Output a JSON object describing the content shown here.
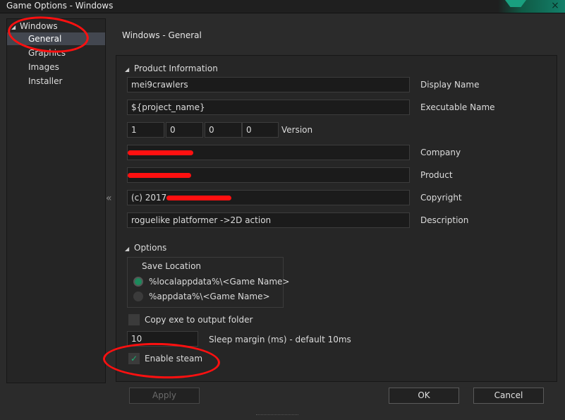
{
  "window": {
    "title": "Game Options - Windows"
  },
  "tree": {
    "root": "Windows",
    "items": [
      {
        "label": "General",
        "selected": true
      },
      {
        "label": "Graphics",
        "selected": false
      },
      {
        "label": "Images",
        "selected": false
      },
      {
        "label": "Installer",
        "selected": false
      }
    ]
  },
  "page": {
    "title": "Windows - General"
  },
  "product_info": {
    "heading": "Product Information",
    "display_name": {
      "value": "mei9crawlers",
      "label": "Display Name"
    },
    "executable_name": {
      "value": "${project_name}",
      "label": "Executable Name"
    },
    "version": {
      "major": "1",
      "minor": "0",
      "build": "0",
      "revision": "0",
      "label": "Version"
    },
    "company": {
      "value": "",
      "label": "Company"
    },
    "product": {
      "value": "",
      "label": "Product"
    },
    "copyright": {
      "value": "(c) 2017",
      "label": "Copyright"
    },
    "description": {
      "value": "roguelike platformer ->2D action",
      "label": "Description"
    }
  },
  "options": {
    "heading": "Options",
    "save_location": {
      "label": "Save Location",
      "choices": [
        {
          "label": "%localappdata%\\<Game Name>",
          "selected": true
        },
        {
          "label": "%appdata%\\<Game Name>",
          "selected": false
        }
      ]
    },
    "copy_exe": {
      "label": "Copy exe to output folder",
      "checked": false
    },
    "sleep_margin": {
      "value": "10",
      "label": "Sleep margin (ms) - default 10ms"
    },
    "enable_steam": {
      "label": "Enable steam",
      "checked": true
    }
  },
  "buttons": {
    "apply": "Apply",
    "ok": "OK",
    "cancel": "Cancel"
  },
  "colors": {
    "accent": "#1c8a5c",
    "annotation": "#ff1010",
    "title_accent": "#13806a"
  },
  "icons": {
    "close": "×",
    "check": "✓",
    "collapse": "«",
    "expanded": "◢"
  }
}
